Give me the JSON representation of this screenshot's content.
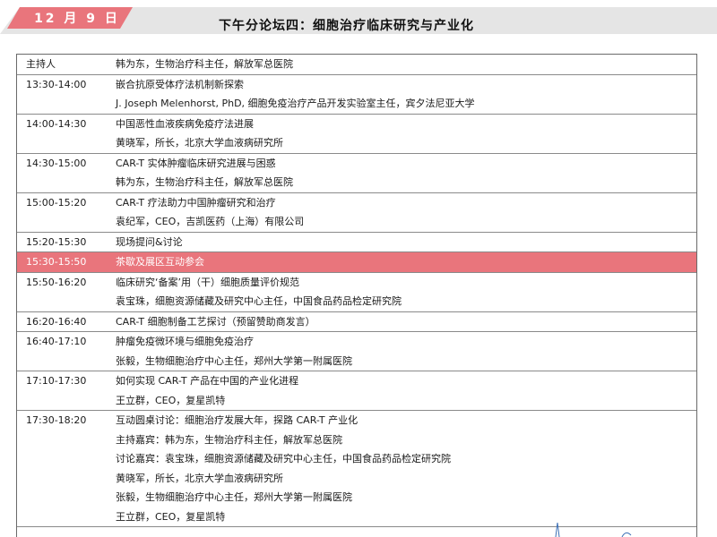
{
  "header": {
    "date": "12 月 9 日",
    "title": "下午分论坛四：细胞治疗临床研究与产业化"
  },
  "colors": {
    "accent": "#e9757c",
    "banner_bg": "#e5e5e5"
  },
  "schedule": [
    {
      "time": "主持人",
      "lines": [
        "韩为东，生物治疗科主任，解放军总医院"
      ]
    },
    {
      "time": "13:30-14:00",
      "lines": [
        "嵌合抗原受体疗法机制新探索",
        "J. Joseph Melenhorst, PhD, 细胞免疫治疗产品开发实验室主任，宾夕法尼亚大学"
      ]
    },
    {
      "time": "14:00-14:30",
      "lines": [
        "中国恶性血液疾病免疫疗法进展",
        "黄晓军，所长，北京大学血液病研究所"
      ]
    },
    {
      "time": "14:30-15:00",
      "lines": [
        "CAR-T 实体肿瘤临床研究进展与困惑",
        "韩为东，生物治疗科主任，解放军总医院"
      ]
    },
    {
      "time": "15:00-15:20",
      "lines": [
        "CAR-T 疗法助力中国肿瘤研究和治疗",
        "袁纪军，CEO，吉凯医药（上海）有限公司"
      ]
    },
    {
      "time": "15:20-15:30",
      "lines": [
        "现场提问&讨论"
      ]
    },
    {
      "time": "15:30-15:50",
      "lines": [
        "茶歇及展区互动参会"
      ],
      "highlight": true
    },
    {
      "time": "15:50-16:20",
      "lines": [
        "临床研究‘备案’用（干）细胞质量评价规范",
        "袁宝珠，细胞资源储藏及研究中心主任，中国食品药品检定研究院"
      ]
    },
    {
      "time": "16:20-16:40",
      "lines": [
        "CAR-T 细胞制备工艺探讨（预留赞助商发言）"
      ]
    },
    {
      "time": "16:40-17:10",
      "lines": [
        "肿瘤免疫微环境与细胞免疫治疗",
        "张毅，生物细胞治疗中心主任，郑州大学第一附属医院"
      ]
    },
    {
      "time": "17:10-17:30",
      "lines": [
        "如何实现 CAR-T 产品在中国的产业化进程",
        "王立群，CEO，复星凯特"
      ]
    },
    {
      "time": "17:30-18:20",
      "lines": [
        "互动圆桌讨论：细胞治疗发展大年，探路 CAR-T 产业化",
        "主持嘉宾：韩为东，生物治疗科主任，解放军总医院",
        "讨论嘉宾：袁宝珠，细胞资源储藏及研究中心主任，中国食品药品检定研究院",
        "黄晓军，所长，北京大学血液病研究所",
        "张毅，生物细胞治疗中心主任，郑州大学第一附属医院",
        "王立群，CEO，复星凯特"
      ]
    }
  ]
}
